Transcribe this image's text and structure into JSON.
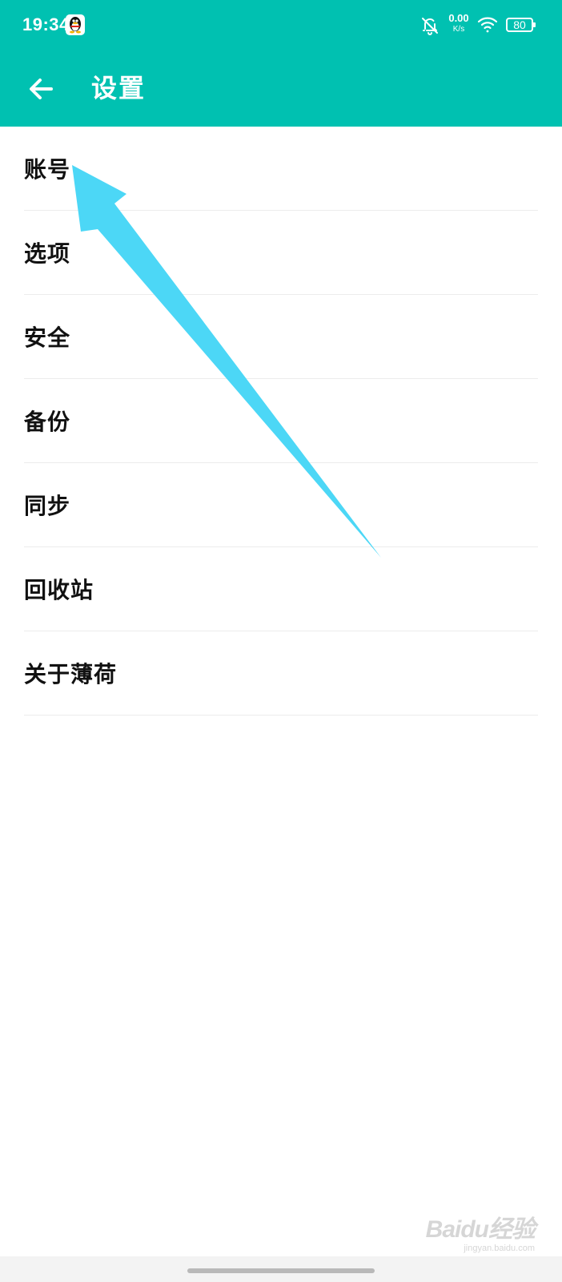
{
  "status_bar": {
    "time": "19:34",
    "net_speed_value": "0.00",
    "net_speed_unit": "K/s",
    "battery": "80",
    "background_color": "#00C1B1",
    "icons": [
      "qq-icon",
      "bell-off-icon",
      "wifi-icon",
      "battery-icon"
    ]
  },
  "app_bar": {
    "title": "设置",
    "back_icon": "arrow-left-icon",
    "background_color": "#00C1B1"
  },
  "settings": {
    "items": [
      {
        "label": "账号"
      },
      {
        "label": "选项"
      },
      {
        "label": "安全"
      },
      {
        "label": "备份"
      },
      {
        "label": "同步"
      },
      {
        "label": "回收站"
      },
      {
        "label": "关于薄荷"
      }
    ]
  },
  "annotation": {
    "type": "arrow",
    "points_to": "账号",
    "color": "#4CD7F6"
  },
  "watermark": {
    "logo": "Baidu经验",
    "subtext": "jingyan.baidu.com"
  },
  "nav_bar": {
    "gesture_indicator": "gesture-pill"
  }
}
